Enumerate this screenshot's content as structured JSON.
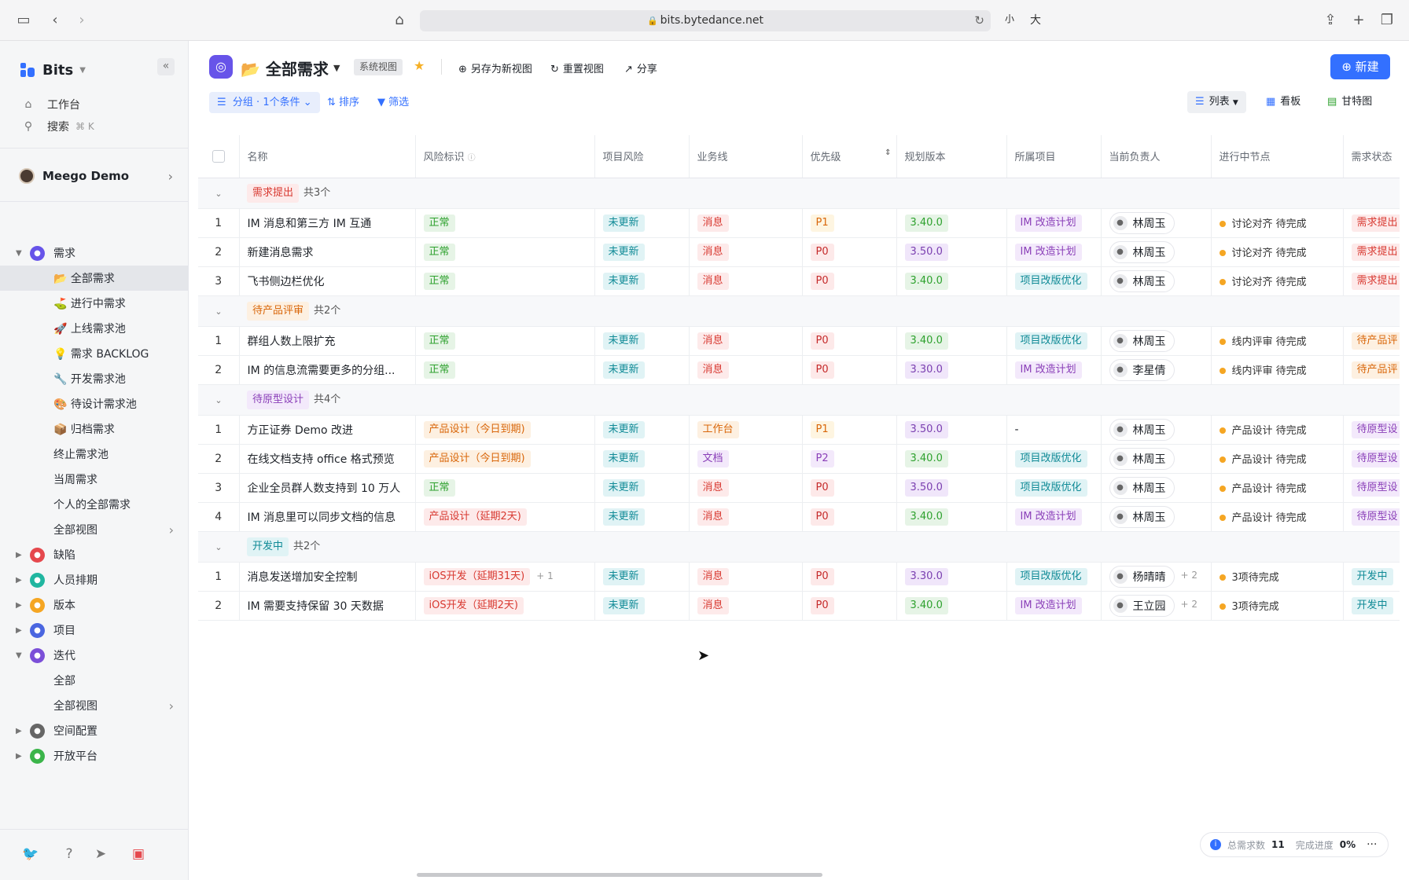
{
  "browser": {
    "url": "bits.bytedance.net",
    "font_small": "小",
    "font_large": "大"
  },
  "sidebar": {
    "app_name": "Bits",
    "workbench": "工作台",
    "search": "搜索",
    "search_shortcut": "⌘ K",
    "workspace": "Meego Demo",
    "tree": [
      {
        "label": "需求",
        "color": "#6754e9",
        "expanded": true
      },
      {
        "label": "全部需求",
        "emoji": "📂",
        "selected": true
      },
      {
        "label": "进行中需求",
        "emoji": "⛳"
      },
      {
        "label": "上线需求池",
        "emoji": "🚀"
      },
      {
        "label": "需求 BACKLOG",
        "emoji": "💡"
      },
      {
        "label": "开发需求池",
        "emoji": "🔧"
      },
      {
        "label": "待设计需求池",
        "emoji": "🎨"
      },
      {
        "label": "归档需求",
        "emoji": "📦"
      },
      {
        "label": "终止需求池"
      },
      {
        "label": "当周需求"
      },
      {
        "label": "个人的全部需求"
      },
      {
        "label": "全部视图",
        "more": true
      },
      {
        "label": "缺陷",
        "color": "#e5484d"
      },
      {
        "label": "人员排期",
        "color": "#20b6a0"
      },
      {
        "label": "版本",
        "color": "#f5a623"
      },
      {
        "label": "项目",
        "color": "#4a66e0"
      },
      {
        "label": "迭代",
        "color": "#7b4fd8",
        "expanded": true
      },
      {
        "label": "全部"
      },
      {
        "label": "全部视图",
        "more": true
      },
      {
        "label": "空间配置",
        "color": "#666"
      },
      {
        "label": "开放平台",
        "color": "#3bb54a"
      }
    ]
  },
  "header": {
    "title": "全部需求",
    "title_emoji": "📂",
    "system_tag": "系统视图",
    "save_as": "另存为新视图",
    "reset": "重置视图",
    "share": "分享",
    "new_btn": "新建",
    "group": "分组 · 1个条件",
    "sort": "排序",
    "filter": "筛选",
    "view_list": "列表",
    "view_board": "看板",
    "view_gantt": "甘特图"
  },
  "table": {
    "columns": [
      "名称",
      "风险标识",
      "项目风险",
      "业务线",
      "优先级",
      "规划版本",
      "所属项目",
      "当前负责人",
      "进行中节点",
      "需求状态"
    ],
    "groups": [
      {
        "name": "需求提出",
        "count": "共3个",
        "tag": "red",
        "rows": [
          {
            "n": "1",
            "name": "IM 消息和第三方 IM 互通",
            "risk": "正常",
            "rc": "green",
            "proj_risk": "未更新",
            "line": "消息",
            "lc": "red",
            "pri": "P1",
            "ver": "3.40.0",
            "vc": "vG",
            "proj": "IM 改造计划",
            "pc": "purple",
            "owner": "林周玉",
            "plus": "",
            "node": "讨论对齐 待完成",
            "status": "需求提出",
            "sc": "red"
          },
          {
            "n": "2",
            "name": "新建消息需求",
            "risk": "正常",
            "rc": "green",
            "proj_risk": "未更新",
            "line": "消息",
            "lc": "red",
            "pri": "P0",
            "ver": "3.50.0",
            "vc": "vV",
            "proj": "IM 改造计划",
            "pc": "purple",
            "owner": "林周玉",
            "plus": "",
            "node": "讨论对齐 待完成",
            "status": "需求提出",
            "sc": "red"
          },
          {
            "n": "3",
            "name": "飞书侧边栏优化",
            "risk": "正常",
            "rc": "green",
            "proj_risk": "未更新",
            "line": "消息",
            "lc": "red",
            "pri": "P0",
            "ver": "3.40.0",
            "vc": "vG",
            "proj": "项目改版优化",
            "pc": "teal",
            "owner": "林周玉",
            "plus": "",
            "node": "讨论对齐 待完成",
            "status": "需求提出",
            "sc": "red"
          }
        ]
      },
      {
        "name": "待产品评审",
        "count": "共2个",
        "tag": "orange",
        "rows": [
          {
            "n": "1",
            "name": "群组人数上限扩充",
            "risk": "正常",
            "rc": "green",
            "proj_risk": "未更新",
            "line": "消息",
            "lc": "red",
            "pri": "P0",
            "ver": "3.40.0",
            "vc": "vG",
            "proj": "项目改版优化",
            "pc": "teal",
            "owner": "林周玉",
            "plus": "",
            "node": "线内评审 待完成",
            "status": "待产品评",
            "sc": "orange"
          },
          {
            "n": "2",
            "name": "IM 的信息流需要更多的分组...",
            "risk": "正常",
            "rc": "green",
            "proj_risk": "未更新",
            "line": "消息",
            "lc": "red",
            "pri": "P0",
            "ver": "3.30.0",
            "vc": "vV",
            "proj": "IM 改造计划",
            "pc": "purple",
            "owner": "李星倩",
            "plus": "",
            "node": "线内评审 待完成",
            "status": "待产品评",
            "sc": "orange"
          }
        ]
      },
      {
        "name": "待原型设计",
        "count": "共4个",
        "tag": "purple",
        "rows": [
          {
            "n": "1",
            "name": "方正证券 Demo 改进",
            "risk": "产品设计（今日到期)",
            "rc": "orange",
            "proj_risk": "未更新",
            "line": "工作台",
            "lc": "orange",
            "pri": "P1",
            "ver": "3.50.0",
            "vc": "vV",
            "proj": "-",
            "pc": "",
            "owner": "林周玉",
            "plus": "",
            "node": "产品设计 待完成",
            "status": "待原型设",
            "sc": "purple"
          },
          {
            "n": "2",
            "name": "在线文档支持 office 格式预览",
            "risk": "产品设计（今日到期)",
            "rc": "orange",
            "proj_risk": "未更新",
            "line": "文档",
            "lc": "purple",
            "pri": "P2",
            "ver": "3.40.0",
            "vc": "vG",
            "proj": "项目改版优化",
            "pc": "teal",
            "owner": "林周玉",
            "plus": "",
            "node": "产品设计 待完成",
            "status": "待原型设",
            "sc": "purple"
          },
          {
            "n": "3",
            "name": "企业全员群人数支持到 10 万人",
            "risk": "正常",
            "rc": "green",
            "proj_risk": "未更新",
            "line": "消息",
            "lc": "red",
            "pri": "P0",
            "ver": "3.50.0",
            "vc": "vV",
            "proj": "项目改版优化",
            "pc": "teal",
            "owner": "林周玉",
            "plus": "",
            "node": "产品设计 待完成",
            "status": "待原型设",
            "sc": "purple"
          },
          {
            "n": "4",
            "name": "IM 消息里可以同步文档的信息",
            "risk": "产品设计（延期2天)",
            "rc": "red",
            "proj_risk": "未更新",
            "line": "消息",
            "lc": "red",
            "pri": "P0",
            "ver": "3.40.0",
            "vc": "vG",
            "proj": "IM 改造计划",
            "pc": "purple",
            "owner": "林周玉",
            "plus": "",
            "node": "产品设计 待完成",
            "status": "待原型设",
            "sc": "purple"
          }
        ]
      },
      {
        "name": "开发中",
        "count": "共2个",
        "tag": "teal",
        "rows": [
          {
            "n": "1",
            "name": "消息发送增加安全控制",
            "risk": "iOS开发（延期31天)",
            "rc": "red",
            "risk_plus": "+ 1",
            "proj_risk": "未更新",
            "line": "消息",
            "lc": "red",
            "pri": "P0",
            "ver": "3.30.0",
            "vc": "vV",
            "proj": "项目改版优化",
            "pc": "teal",
            "owner": "杨晴晴",
            "plus": "+ 2",
            "node": "3项待完成",
            "status": "开发中",
            "sc": "teal"
          },
          {
            "n": "2",
            "name": "IM 需要支持保留 30 天数据",
            "risk": "iOS开发（延期2天)",
            "rc": "red",
            "proj_risk": "未更新",
            "line": "消息",
            "lc": "red",
            "pri": "P0",
            "ver": "3.40.0",
            "vc": "vG",
            "proj": "IM 改造计划",
            "pc": "purple",
            "owner": "王立园",
            "plus": "+ 2",
            "node": "3项待完成",
            "status": "开发中",
            "sc": "teal"
          }
        ]
      }
    ]
  },
  "footer": {
    "total_label": "总需求数",
    "total": "11",
    "progress_label": "完成进度",
    "progress": "0%"
  }
}
